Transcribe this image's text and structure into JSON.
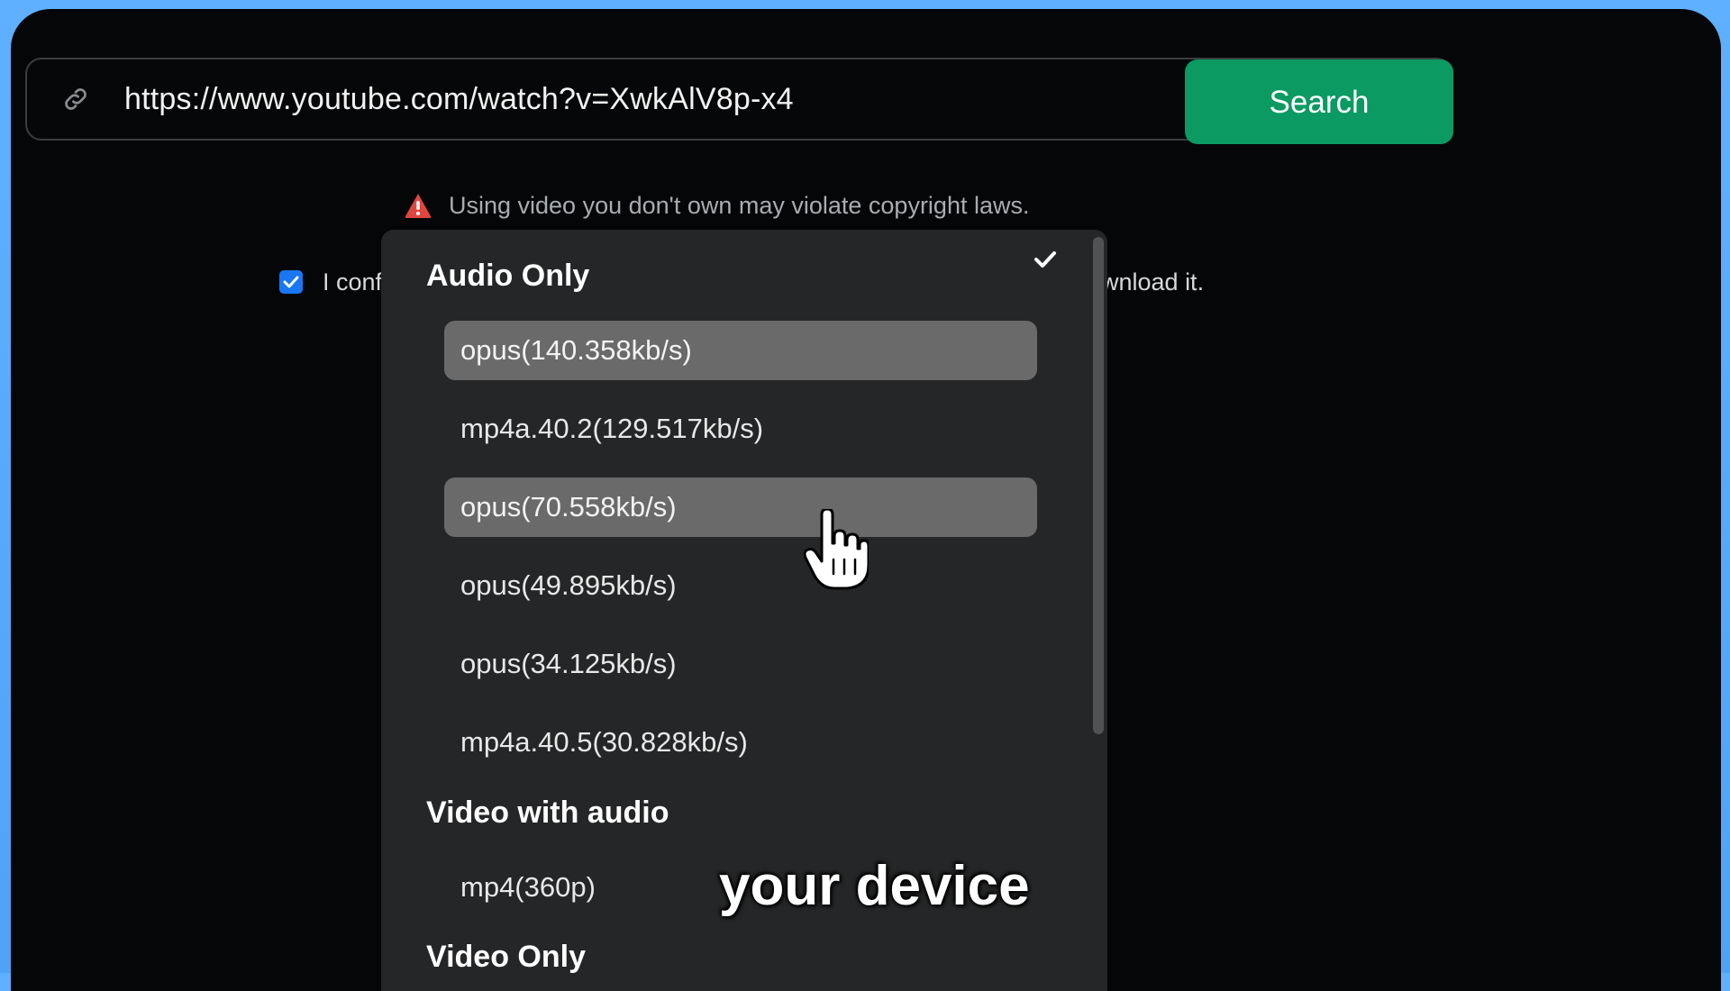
{
  "url_bar": {
    "value": "https://www.youtube.com/watch?v=XwkAlV8p-x4",
    "icon": "link-icon"
  },
  "search_button": {
    "label": "Search",
    "color": "#0a9a62"
  },
  "warning": {
    "icon": "warning-icon",
    "text": "Using video you don't own may violate copyright laws."
  },
  "confirm": {
    "checked": true,
    "text_start": "I conf",
    "text_end": "wnload it."
  },
  "dropdown": {
    "selected_indicator": "check-icon",
    "groups": [
      {
        "label": "Audio Only",
        "options": [
          {
            "label": "opus(140.358kb/s)",
            "highlighted": true
          },
          {
            "label": "mp4a.40.2(129.517kb/s)",
            "highlighted": false
          },
          {
            "label": "opus(70.558kb/s)",
            "highlighted": true
          },
          {
            "label": "opus(49.895kb/s)",
            "highlighted": false
          },
          {
            "label": "opus(34.125kb/s)",
            "highlighted": false
          },
          {
            "label": "mp4a.40.5(30.828kb/s)",
            "highlighted": false
          }
        ]
      },
      {
        "label": "Video with audio",
        "options": [
          {
            "label": "mp4(360p)",
            "highlighted": false
          }
        ]
      },
      {
        "label": "Video Only",
        "options": []
      }
    ]
  },
  "subtitle": "your device",
  "cursor": "hand-pointer-icon"
}
